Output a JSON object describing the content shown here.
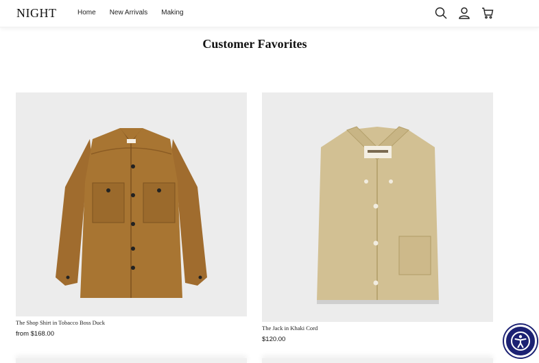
{
  "header": {
    "logo": "NIGHT",
    "nav": [
      {
        "label": "Home"
      },
      {
        "label": "New Arrivals"
      },
      {
        "label": "Making"
      }
    ],
    "icons": [
      "search-icon",
      "account-icon",
      "cart-icon"
    ]
  },
  "section": {
    "title": "Customer Favorites"
  },
  "products": [
    {
      "name": "The Shop Shirt in Tobacco Boss Duck",
      "price": "from $168.00",
      "image": "tobacco-shop-shirt-image",
      "color": "#a87532"
    },
    {
      "name": "The Jack in Khaki Cord",
      "price": "$120.00",
      "image": "khaki-cord-shirt-image",
      "color": "#d2c093"
    }
  ],
  "accessibility": {
    "icon": "accessibility-icon",
    "color": "#1c2173"
  }
}
